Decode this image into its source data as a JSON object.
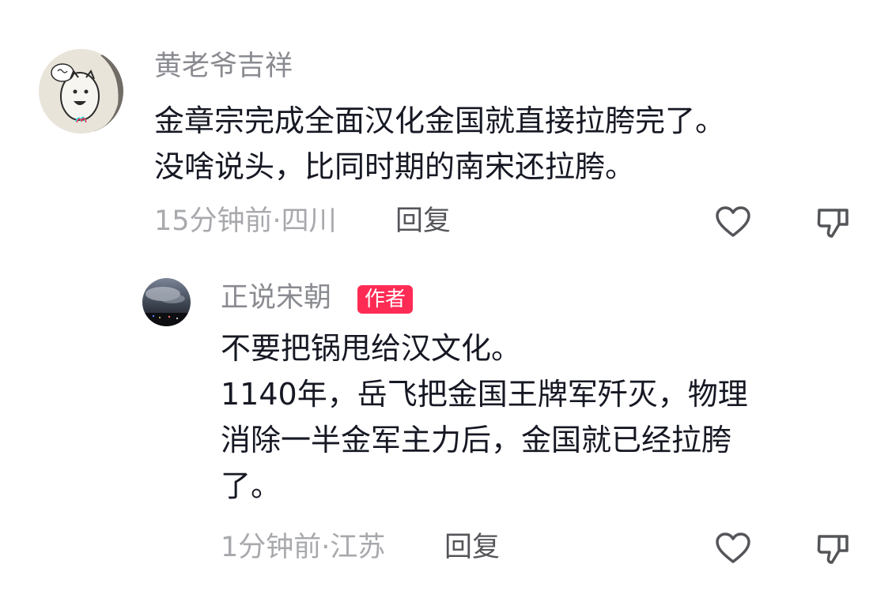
{
  "comments": [
    {
      "username": "黄老爷吉祥",
      "avatar_icon": "cartoon-cat-avatar",
      "text_lines": [
        "金章宗完成全面汉化金国就直接拉胯完了。",
        "没啥说头，比同时期的南宋还拉胯。"
      ],
      "meta": "15分钟前·四川",
      "reply_label": "回复",
      "like_icon": "heart-icon",
      "dislike_icon": "thumbs-down-icon"
    },
    {
      "username": "正说宋朝",
      "avatar_icon": "night-city-avatar",
      "badge": "作者",
      "text_lines": [
        "不要把锅甩给汉文化。",
        "1140年，岳飞把金国王牌军歼灭，物理",
        "消除一半金军主力后，金国就已经拉胯",
        "了。"
      ],
      "meta": "1分钟前·江苏",
      "reply_label": "回复",
      "like_icon": "heart-icon",
      "dislike_icon": "thumbs-down-icon"
    }
  ],
  "colors": {
    "badge_bg": "#fe2c55",
    "text": "#161823",
    "username": "#8a8b91",
    "meta": "#a8a9ad"
  }
}
